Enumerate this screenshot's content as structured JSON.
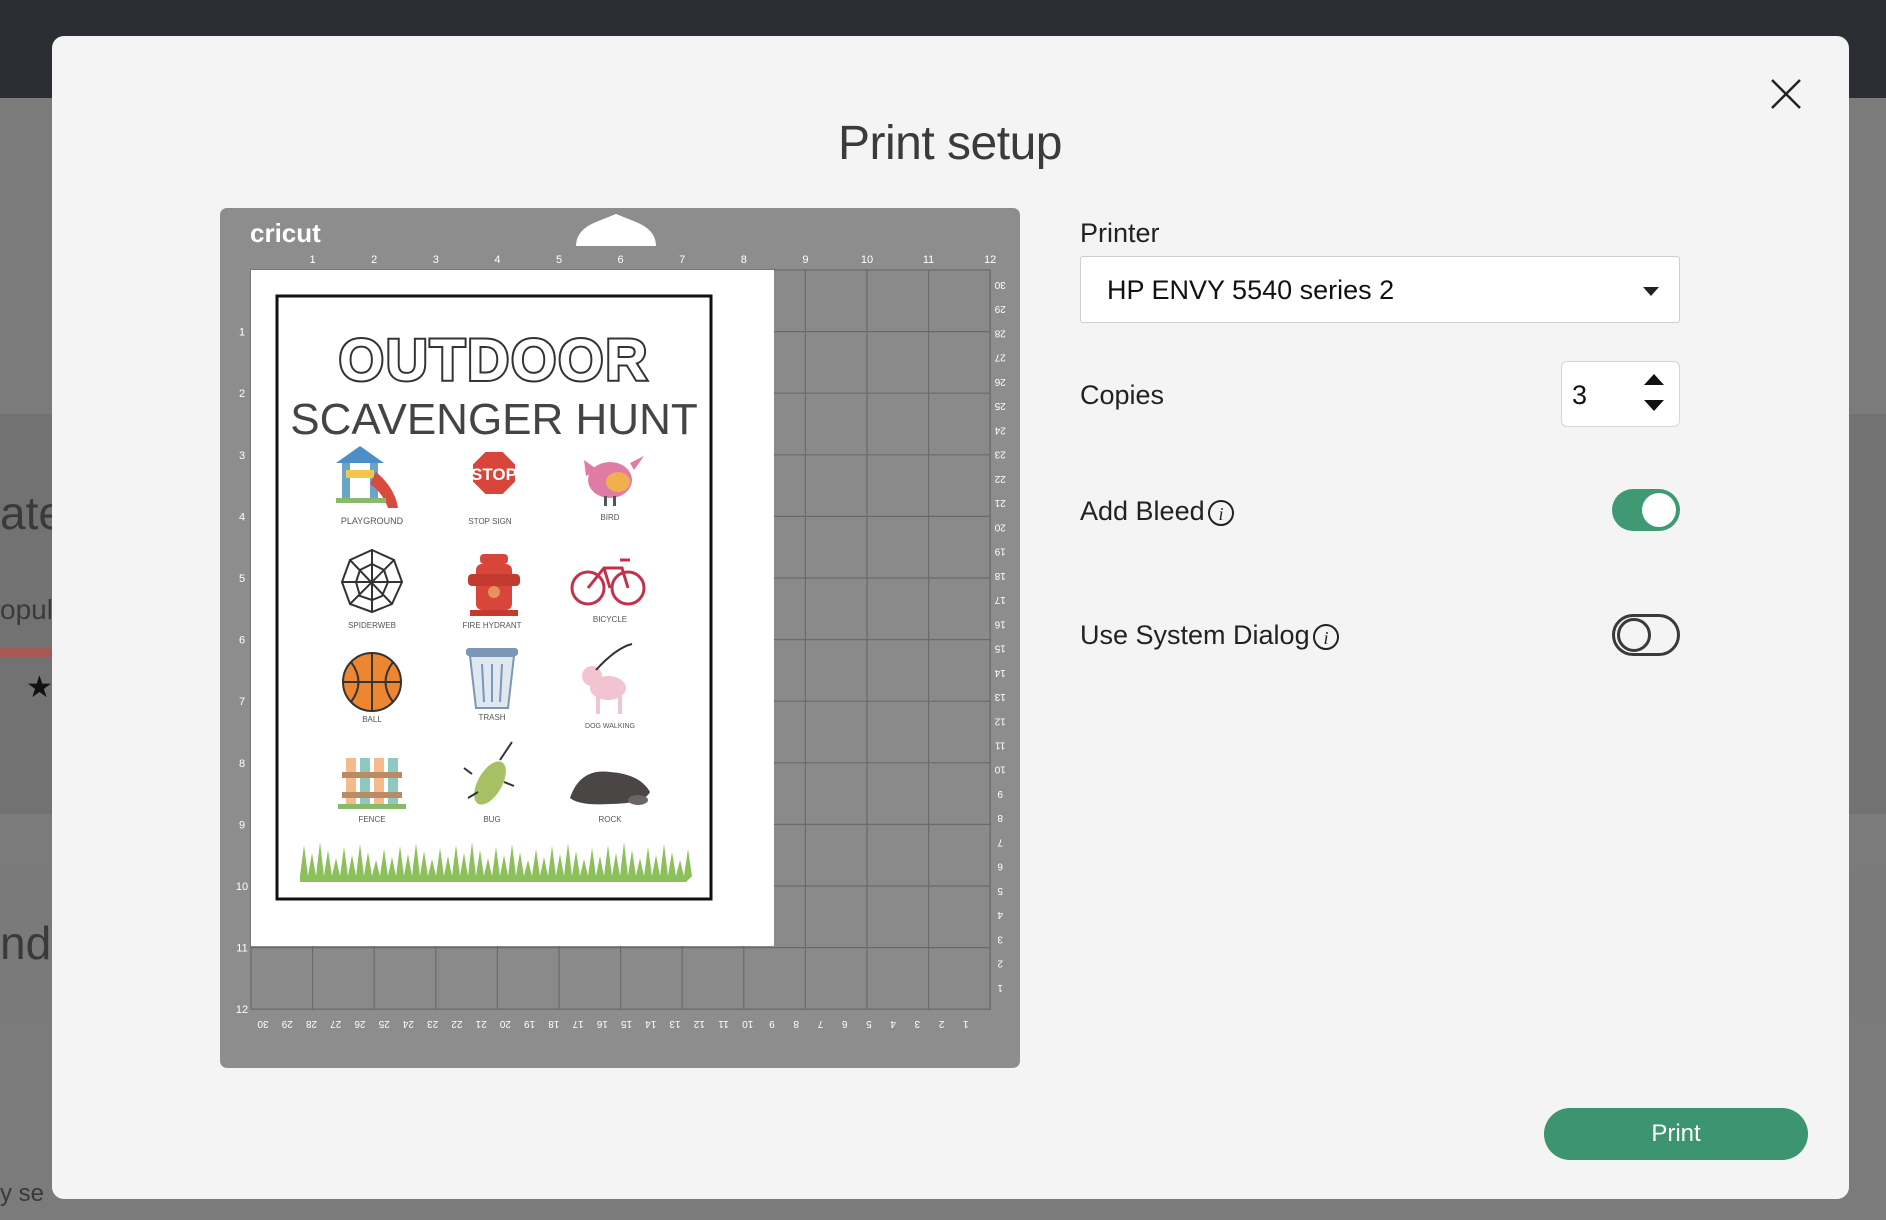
{
  "background": {
    "fragments": [
      "ate",
      "opula",
      "nd",
      "y se"
    ]
  },
  "dialog": {
    "title": "Print setup",
    "close_icon": "close-icon"
  },
  "mat": {
    "brand": "cricut",
    "top_ruler": [
      "1",
      "2",
      "3",
      "4",
      "5",
      "6",
      "7",
      "8",
      "9",
      "10",
      "11",
      "12"
    ],
    "left_ruler": [
      "1",
      "2",
      "3",
      "4",
      "5",
      "6",
      "7",
      "8",
      "9",
      "10",
      "11",
      "12"
    ],
    "right_ruler_cm": [
      "30",
      "29",
      "28",
      "27",
      "26",
      "25",
      "24",
      "23",
      "22",
      "21",
      "20",
      "19",
      "18",
      "17",
      "16",
      "15",
      "14",
      "13",
      "12",
      "11",
      "10",
      "9",
      "8",
      "7",
      "6",
      "5",
      "4",
      "3",
      "2",
      "1"
    ],
    "bottom_ruler_cm": [
      "30",
      "29",
      "28",
      "27",
      "26",
      "25",
      "24",
      "23",
      "22",
      "21",
      "20",
      "19",
      "18",
      "17",
      "16",
      "15",
      "14",
      "13",
      "12",
      "11",
      "10",
      "9",
      "8",
      "7",
      "6",
      "5",
      "4",
      "3",
      "2",
      "1"
    ]
  },
  "document": {
    "title_line1": "OUTDOOR",
    "title_line2": "SCAVENGER HUNT",
    "items": [
      "PLAYGROUND",
      "STOP SIGN",
      "BIRD",
      "SPIDERWEB",
      "FIRE HYDRANT",
      "BICYCLE",
      "BALL",
      "TRASH",
      "DOG WALKING",
      "FENCE",
      "BUG",
      "ROCK"
    ],
    "stop_text": "STOP"
  },
  "form": {
    "printer_label": "Printer",
    "printer_value": "HP ENVY 5540 series 2",
    "copies_label": "Copies",
    "copies_value": "3",
    "bleed_label": "Add Bleed",
    "bleed_on": true,
    "system_dialog_label": "Use System Dialog",
    "system_dialog_on": false,
    "print_label": "Print"
  },
  "colors": {
    "accent": "#3f9a74",
    "mat": "#8d8d8d"
  }
}
